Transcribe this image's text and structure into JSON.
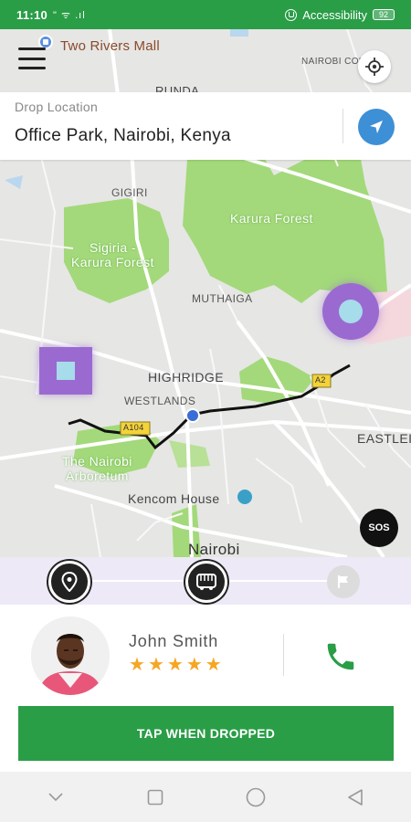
{
  "status_bar": {
    "time": "11:10",
    "indicators": "\" ᯤ .ıl",
    "accessibility_label": "Accessibility",
    "battery": "92"
  },
  "header": {
    "menu_icon": "hamburger-menu-icon",
    "place_name": "Two Rivers Mall",
    "locate_icon": "crosshair-locate-icon"
  },
  "drop": {
    "label": "Drop Location",
    "value": "Office Park, Nairobi, Kenya",
    "nav_icon": "navigation-arrow-icon"
  },
  "map": {
    "labels": {
      "nairobi_county": "NAIROBI COUNTY",
      "runda": "RUNDA",
      "gigiri": "GIGIRI",
      "karura_forest": "Karura Forest",
      "sigiria": "Sigiria -\nKarura Forest",
      "muthaiga": "MUTHAIGA",
      "highridge": "HIGHRIDGE",
      "westlands": "WESTLANDS",
      "eastleigh": "EASTLEIG",
      "arboretum": "The Nairobi\nArboretum",
      "kencom": "Kencom House",
      "nairobi": "Nairobi",
      "a2": "A2",
      "a104": "A104"
    },
    "sos_label": "SOS",
    "colors": {
      "park_green": "#a3d97a",
      "marker_purple": "#9a6ad1",
      "marker_inner": "#a7dcea",
      "route": "#111111"
    }
  },
  "progress": {
    "steps": [
      {
        "icon": "pin-icon",
        "state": "active"
      },
      {
        "icon": "bus-icon",
        "state": "active"
      },
      {
        "icon": "flag-icon",
        "state": "inactive"
      }
    ]
  },
  "driver": {
    "name": "John Smith",
    "rating": 5,
    "stars": [
      "★",
      "★",
      "★",
      "★",
      "★"
    ],
    "call_icon": "phone-icon"
  },
  "cta": {
    "label": "TAP WHEN DROPPED",
    "color": "#2a9d47"
  },
  "nav_bar": {
    "items": [
      "chevron-down-icon",
      "square-recent-icon",
      "circle-home-icon",
      "triangle-back-icon"
    ]
  }
}
